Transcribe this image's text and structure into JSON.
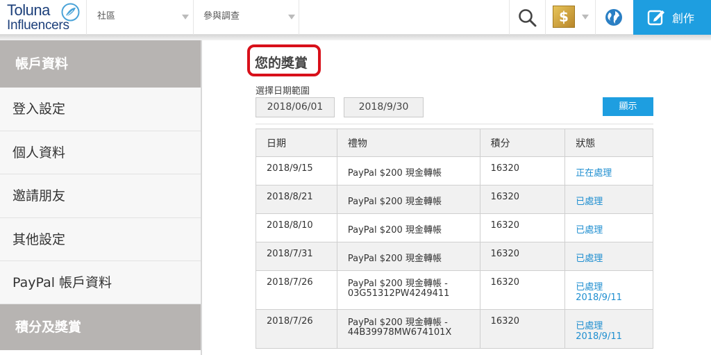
{
  "header": {
    "logo_top": "Toluna",
    "logo_bottom": "Influencers",
    "nav_community": "社區",
    "nav_surveys": "參與調查",
    "create_label": "創作",
    "avatar_glyph": "$"
  },
  "sidebar": {
    "account_header": "帳戶資料",
    "items": [
      "登入設定",
      "個人資料",
      "邀請朋友",
      "其他設定",
      "PayPal 帳戶資料"
    ],
    "points_header": "積分及獎賞"
  },
  "main": {
    "title": "您的獎賞",
    "range_label": "選擇日期範圍",
    "date_from": "2018/06/01",
    "date_to": "2018/9/30",
    "show_label": "顯示",
    "columns": [
      "日期",
      "禮物",
      "積分",
      "狀態"
    ],
    "rows": [
      {
        "date": "2018/9/15",
        "gift": "PayPal $200 現金轉帳",
        "gift_code": "",
        "points": "16320",
        "status": "正在處理"
      },
      {
        "date": "2018/8/21",
        "gift": "PayPal $200 現金轉帳",
        "gift_code": "",
        "points": "16320",
        "status": "已處理"
      },
      {
        "date": "2018/8/10",
        "gift": "PayPal $200 現金轉帳",
        "gift_code": "",
        "points": "16320",
        "status": "已處理"
      },
      {
        "date": "2018/7/31",
        "gift": "PayPal $200 現金轉帳",
        "gift_code": "",
        "points": "16320",
        "status": "已處理"
      },
      {
        "date": "2018/7/26",
        "gift": "PayPal $200 現金轉帳 -",
        "gift_code": "03G51312PW4249411",
        "points": "16320",
        "status": "已處理 2018/9/11"
      },
      {
        "date": "2018/7/26",
        "gift": "PayPal $200 現金轉帳 -",
        "gift_code": "44B39978MW674101X",
        "points": "16320",
        "status": "已處理 2018/9/11"
      }
    ]
  },
  "icons": {
    "search": "search-icon",
    "globe": "globe-icon",
    "create": "edit-icon",
    "logo_mark": "leaf-logo-icon"
  },
  "colors": {
    "accent_blue": "#1e9ee0",
    "link_blue": "#1e8ed0",
    "highlight_red": "#d8101a",
    "sidebar_header_gray": "#b7b4b2"
  }
}
